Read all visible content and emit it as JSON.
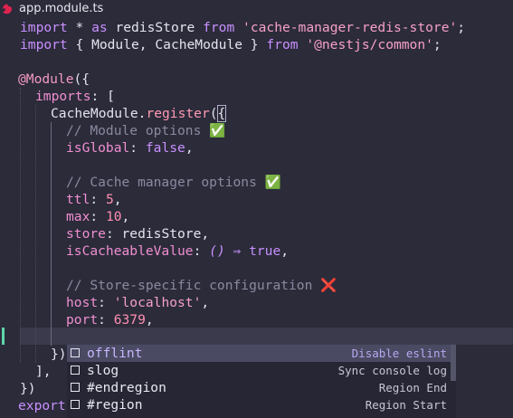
{
  "tab": {
    "title": "app.module.ts",
    "icon": "nestjs-icon",
    "icon_color": "#e0234e"
  },
  "code": {
    "l1": {
      "kw1": "import",
      "p1": " * ",
      "kw2": "as",
      "p2": " redisStore ",
      "kw3": "from",
      "sp": " ",
      "str": "'cache-manager-redis-store'",
      "end": ";"
    },
    "l2": {
      "kw1": "import",
      "p1": " { Module, CacheModule } ",
      "kw2": "from",
      "sp": " ",
      "str": "'@nestjs/common'",
      "end": ";"
    },
    "l4": {
      "dec": "@Module",
      "p": "({"
    },
    "l5": {
      "prop": "imports",
      "p": ": ["
    },
    "l6": {
      "p1": "CacheModule.",
      "fn": "register",
      "p2": "(",
      "br": "{"
    },
    "l7": {
      "cm": "// Module options ",
      "emoji": "✅"
    },
    "l8": {
      "prop": "isGlobal",
      "p": ": ",
      "kw": "false",
      "end": ","
    },
    "l10": {
      "cm": "// Cache manager options ",
      "emoji": "✅"
    },
    "l11": {
      "prop": "ttl",
      "p": ": ",
      "num": "5",
      "end": ","
    },
    "l12": {
      "prop": "max",
      "p": ": ",
      "num": "10",
      "end": ","
    },
    "l13": {
      "prop": "store",
      "p": ": redisStore,"
    },
    "l14": {
      "prop": "isCacheableValue",
      "p": ": ",
      "it": "()",
      "arrow": " ⇒ ",
      "kw": "true",
      "end": ","
    },
    "l16": {
      "cm": "// Store-specific configuration ",
      "emoji": "❌"
    },
    "l17": {
      "prop": "host",
      "p": ": ",
      "str": "'localhost'",
      "end": ","
    },
    "l18": {
      "prop": "port",
      "p": ": ",
      "num": "6379",
      "end": ","
    },
    "l20": {
      "p": "})"
    },
    "l21": {
      "p": "],"
    },
    "l22": {
      "p": "})"
    },
    "l23": {
      "kw": "export"
    }
  },
  "suggestions": [
    {
      "label": "offlint",
      "detail": "Disable eslint",
      "selected": true
    },
    {
      "label": "slog",
      "detail": "Sync console log",
      "selected": false
    },
    {
      "label": "#endregion",
      "detail": "Region End",
      "selected": false
    },
    {
      "label": "#region",
      "detail": "Region Start",
      "selected": false
    }
  ]
}
